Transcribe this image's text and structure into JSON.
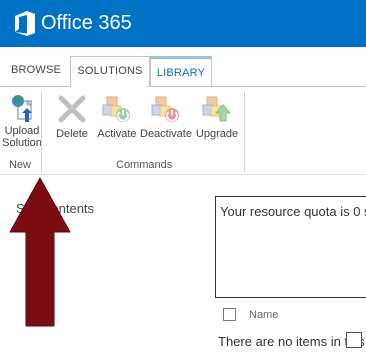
{
  "suite_bar": {
    "brand": "Office 365",
    "color": "#0072c6"
  },
  "tabs": [
    {
      "label": "BROWSE"
    },
    {
      "label": "SOLUTIONS"
    },
    {
      "label": "LIBRARY"
    }
  ],
  "ribbon": {
    "groups": [
      {
        "label": "New",
        "buttons": [
          {
            "label_line1": "Upload",
            "label_line2": "Solution",
            "icon": "upload-solution-icon"
          }
        ]
      },
      {
        "label": "Commands",
        "buttons": [
          {
            "label": "Delete",
            "icon": "delete-x-icon"
          },
          {
            "label": "Activate",
            "icon": "activate-icon"
          },
          {
            "label": "Deactivate",
            "icon": "deactivate-icon"
          },
          {
            "label": "Upgrade",
            "icon": "upgrade-icon"
          }
        ]
      }
    ]
  },
  "left_nav": {
    "site_contents": "Site Contents"
  },
  "quota_message": "Your resource quota is 0 s",
  "list": {
    "column_name": "Name",
    "empty_text": "There are no items in this"
  },
  "annotation": {
    "arrow_color": "#7b0c12"
  }
}
